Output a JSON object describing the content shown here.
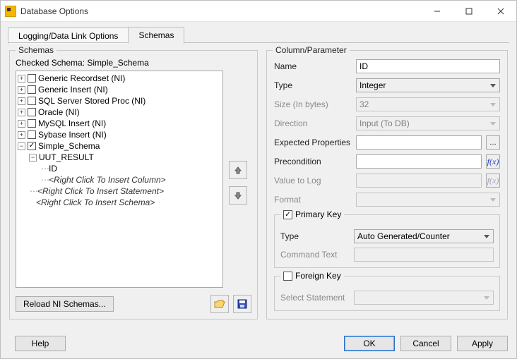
{
  "window": {
    "title": "Database Options"
  },
  "tabs": {
    "logging_label": "Logging/Data Link Options",
    "schemas_label": "Schemas"
  },
  "schemas_group": {
    "legend": "Schemas",
    "checked_label": "Checked Schema: Simple_Schema",
    "reload_label": "Reload NI Schemas...",
    "tree": {
      "items": [
        "Generic Recordset (NI)",
        "Generic Insert (NI)",
        "SQL Server Stored Proc (NI)",
        "Oracle (NI)",
        "MySQL Insert (NI)",
        "Sybase Insert (NI)",
        "Simple_Schema"
      ],
      "uut_result": "UUT_RESULT",
      "id": "ID",
      "insert_column": "<Right Click To Insert Column>",
      "insert_statement": "<Right Click To Insert Statement>",
      "insert_schema": "<Right Click To Insert Schema>"
    }
  },
  "column_group": {
    "legend": "Column/Parameter",
    "name_label": "Name",
    "name_value": "ID",
    "type_label": "Type",
    "type_value": "Integer",
    "size_label": "Size (In bytes)",
    "size_value": "32",
    "direction_label": "Direction",
    "direction_value": "Input (To DB)",
    "expected_label": "Expected Properties",
    "expected_value": "",
    "precondition_label": "Precondition",
    "precondition_value": "",
    "valuelog_label": "Value to Log",
    "valuelog_value": "",
    "format_label": "Format",
    "format_value": "",
    "primary_legend": "Primary Key",
    "primary_checked": true,
    "pk_type_label": "Type",
    "pk_type_value": "Auto Generated/Counter",
    "pk_cmd_label": "Command Text",
    "pk_cmd_value": "",
    "foreign_legend": "Foreign Key",
    "foreign_checked": false,
    "fk_select_label": "Select Statement",
    "fk_select_value": ""
  },
  "buttons": {
    "help": "Help",
    "ok": "OK",
    "cancel": "Cancel",
    "apply": "Apply"
  }
}
